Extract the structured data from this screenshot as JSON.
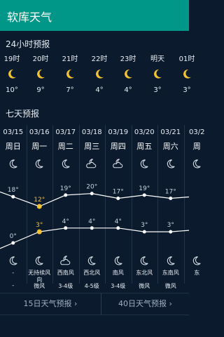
{
  "app": {
    "title": "软库天气"
  },
  "hourly": {
    "section_title": "24小时预报",
    "items": [
      {
        "time": "19时",
        "temp": "10°",
        "icon": "crescent-moon-icon"
      },
      {
        "time": "20时",
        "temp": "9°",
        "icon": "crescent-moon-icon"
      },
      {
        "time": "21时",
        "temp": "7°",
        "icon": "crescent-moon-icon"
      },
      {
        "time": "22时",
        "temp": "4°",
        "icon": "crescent-moon-icon"
      },
      {
        "time": "23时",
        "temp": "4°",
        "icon": "crescent-moon-icon"
      },
      {
        "time": "明天",
        "temp": "3°",
        "icon": "crescent-moon-icon"
      },
      {
        "time": "01时",
        "temp": "3°",
        "icon": "crescent-moon-icon"
      }
    ]
  },
  "daily": {
    "section_title": "七天预报",
    "days": [
      {
        "date": "03/15",
        "weekday": "周日",
        "high": "18°",
        "low": "0°",
        "wind_dir": "-",
        "wind_level": "-",
        "day_icon": "crescent-moon-icon",
        "night_icon": "crescent-moon-icon"
      },
      {
        "date": "03/16",
        "weekday": "周一",
        "high": "12°",
        "low": "3°",
        "wind_dir": "无持续风向",
        "wind_level": "微风",
        "day_icon": "crescent-moon-icon",
        "night_icon": "crescent-moon-icon"
      },
      {
        "date": "03/17",
        "weekday": "周二",
        "high": "19°",
        "low": "4°",
        "wind_dir": "西南风",
        "wind_level": "3-4级",
        "day_icon": "crescent-moon-icon",
        "night_icon": "cloudy-night-icon"
      },
      {
        "date": "03/18",
        "weekday": "周三",
        "high": "20°",
        "low": "4°",
        "wind_dir": "西北风",
        "wind_level": "4-5级",
        "day_icon": "cloudy-night-icon",
        "night_icon": "crescent-moon-icon"
      },
      {
        "date": "03/19",
        "weekday": "周四",
        "high": "17°",
        "low": "4°",
        "wind_dir": "南风",
        "wind_level": "3-4级",
        "day_icon": "cloudy-night-icon",
        "night_icon": "crescent-moon-icon"
      },
      {
        "date": "03/20",
        "weekday": "周五",
        "high": "19°",
        "low": "3°",
        "wind_dir": "东北风",
        "wind_level": "微风",
        "day_icon": "crescent-moon-icon",
        "night_icon": "crescent-moon-icon"
      },
      {
        "date": "03/21",
        "weekday": "周六",
        "high": "17°",
        "low": "3°",
        "wind_dir": "东南风",
        "wind_level": "微风",
        "day_icon": "crescent-moon-icon",
        "night_icon": "crescent-moon-icon"
      },
      {
        "date": "03/2",
        "weekday": "周",
        "high": "",
        "low": "",
        "wind_dir": "东",
        "wind_level": "",
        "day_icon": "crescent-moon-icon",
        "night_icon": "crescent-moon-icon"
      }
    ]
  },
  "footer": {
    "btn_15day": "15日天气预报",
    "btn_40day": "40日天气预报"
  },
  "chart_data": {
    "type": "line",
    "categories": [
      "03/15",
      "03/16",
      "03/17",
      "03/18",
      "03/19",
      "03/20",
      "03/21"
    ],
    "series": [
      {
        "values": [
          18,
          12,
          19,
          20,
          17,
          19,
          17
        ]
      },
      {
        "values": [
          0,
          3,
          4,
          4,
          4,
          3,
          3
        ]
      }
    ],
    "highlight_index": 1
  },
  "colors": {
    "appbar": "#009688",
    "bg": "#0b1a2c",
    "highlight": "#f2c230",
    "line": "#ffffff"
  }
}
